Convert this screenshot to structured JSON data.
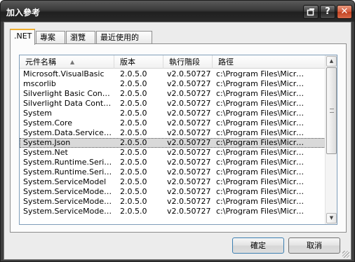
{
  "window": {
    "title": "加入參考",
    "controls": {
      "restore_icon": "restore-icon",
      "help_label": "?",
      "close_label": "✕"
    }
  },
  "tabs": [
    {
      "label": ".NET",
      "active": true
    },
    {
      "label": "專案",
      "active": false
    },
    {
      "label": "瀏覽",
      "active": false
    },
    {
      "label": "最近使用的",
      "active": false
    }
  ],
  "list": {
    "columns": [
      "元件名稱",
      "版本",
      "執行階段",
      "路徑"
    ],
    "sort_indicator": "▲",
    "rows": [
      [
        "Microsoft.VisualBasic",
        "2.0.5.0",
        "v2.0.50727",
        "c:\\Program Files\\Micros..."
      ],
      [
        "mscorlib",
        "2.0.5.0",
        "v2.0.50727",
        "c:\\Program Files\\Micros..."
      ],
      [
        "Silverlight Basic Controls...",
        "2.0.5.0",
        "v2.0.50727",
        "c:\\Program Files\\Micros..."
      ],
      [
        "Silverlight Data Controls...",
        "2.0.5.0",
        "v2.0.50727",
        "c:\\Program Files\\Micros..."
      ],
      [
        "System",
        "2.0.5.0",
        "v2.0.50727",
        "c:\\Program Files\\Micros..."
      ],
      [
        "System.Core",
        "2.0.5.0",
        "v2.0.50727",
        "c:\\Program Files\\Micros..."
      ],
      [
        "System.Data.Services....",
        "2.0.5.0",
        "v2.0.50727",
        "c:\\Program Files\\Micros..."
      ],
      [
        "System.Json",
        "2.0.5.0",
        "v2.0.50727",
        "c:\\Program Files\\Micros..."
      ],
      [
        "System.Net",
        "2.0.5.0",
        "v2.0.50727",
        "c:\\Program Files\\Micros..."
      ],
      [
        "System.Runtime.Serializ...",
        "2.0.5.0",
        "v2.0.50727",
        "c:\\Program Files\\Micros..."
      ],
      [
        "System.Runtime.Serializ...",
        "2.0.5.0",
        "v2.0.50727",
        "c:\\Program Files\\Micros..."
      ],
      [
        "System.ServiceModel",
        "2.0.5.0",
        "v2.0.50727",
        "c:\\Program Files\\Micros..."
      ],
      [
        "System.ServiceModel.P...",
        "2.0.5.0",
        "v2.0.50727",
        "c:\\Program Files\\Micros..."
      ],
      [
        "System.ServiceModel.S...",
        "2.0.5.0",
        "v2.0.50727",
        "c:\\Program Files\\Micros..."
      ],
      [
        "System.ServiceModel.Web",
        "2.0.5.0",
        "v2.0.50727",
        "c:\\Program Files\\Micros..."
      ]
    ],
    "selected_index": 7
  },
  "buttons": {
    "ok_label": "確定",
    "cancel_label": "取消"
  }
}
